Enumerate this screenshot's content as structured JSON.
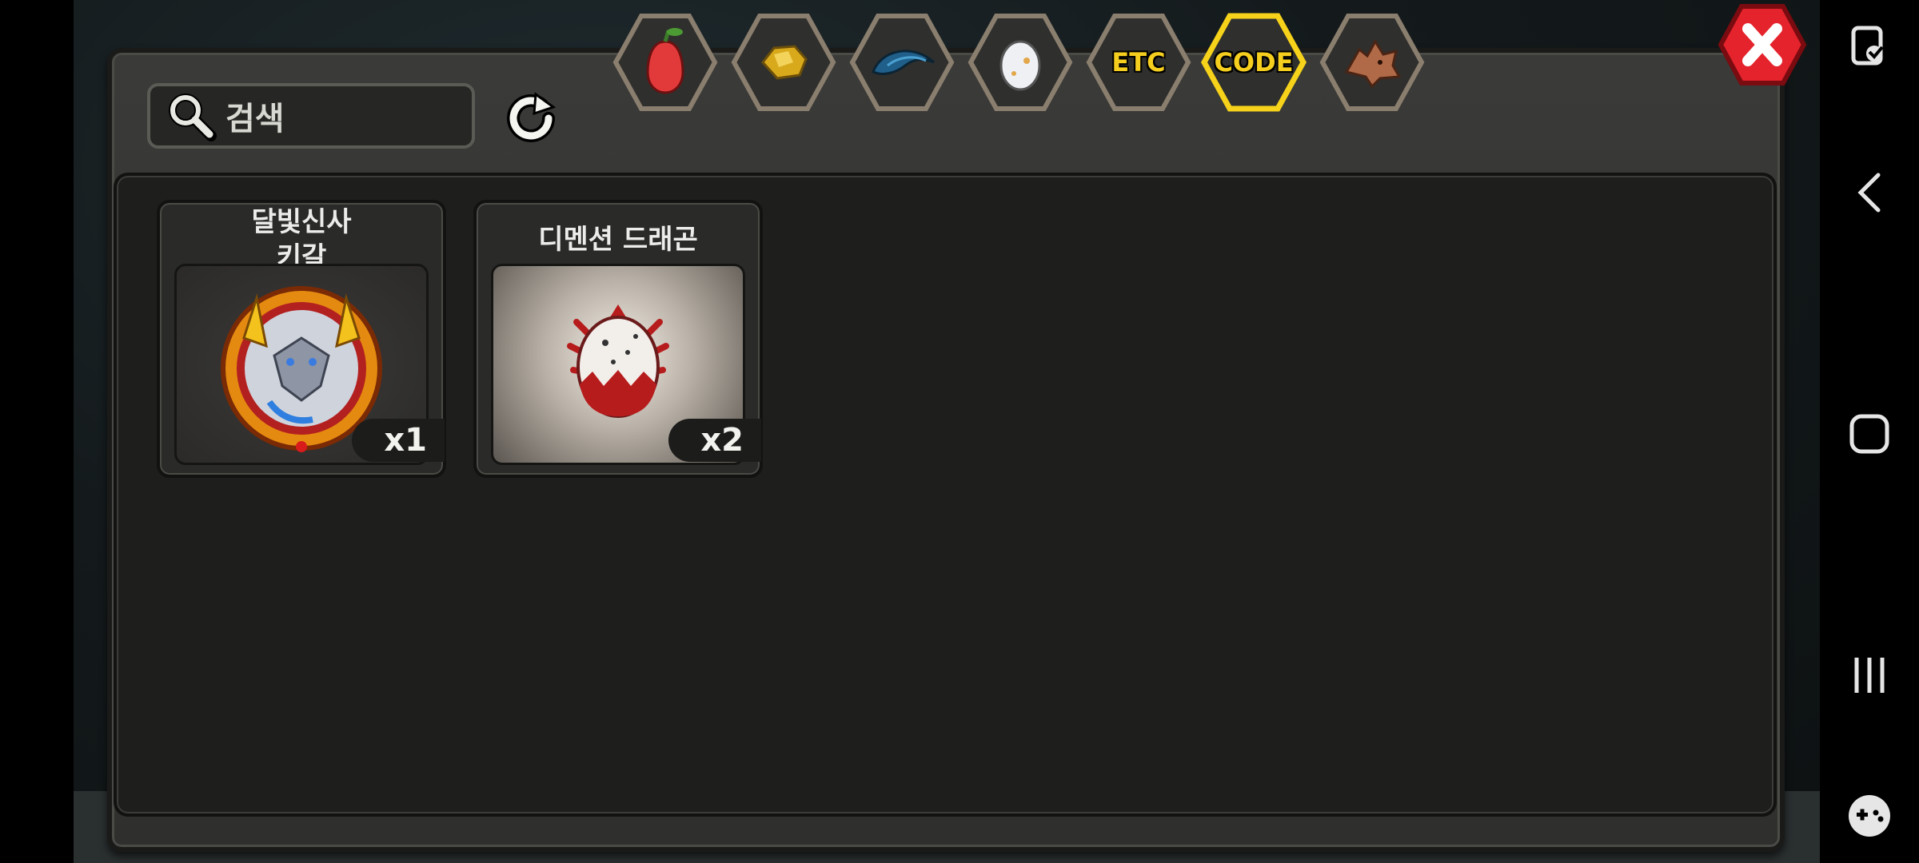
{
  "search": {
    "placeholder": "검색"
  },
  "tabs": [
    {
      "name": "tab-fruit",
      "icon": "pear-icon"
    },
    {
      "name": "tab-material",
      "icon": "gold-ore-icon"
    },
    {
      "name": "tab-scale",
      "icon": "dragon-scale-icon"
    },
    {
      "name": "tab-egg",
      "icon": "egg-icon"
    },
    {
      "name": "tab-etc",
      "label": "ETC"
    },
    {
      "name": "tab-code",
      "label": "CODE",
      "selected": true
    },
    {
      "name": "tab-dragon",
      "icon": "dragon-head-icon"
    }
  ],
  "items": [
    {
      "title": "달빛신사\n키갈",
      "count": "x1",
      "icon": "moonlight-gentleman-badge-icon"
    },
    {
      "title": "디멘션 드래곤",
      "count": "x2",
      "icon": "dragon-egg-icon"
    }
  ],
  "colors": {
    "accent": "#f6cf1e",
    "close": "#e4232c"
  }
}
